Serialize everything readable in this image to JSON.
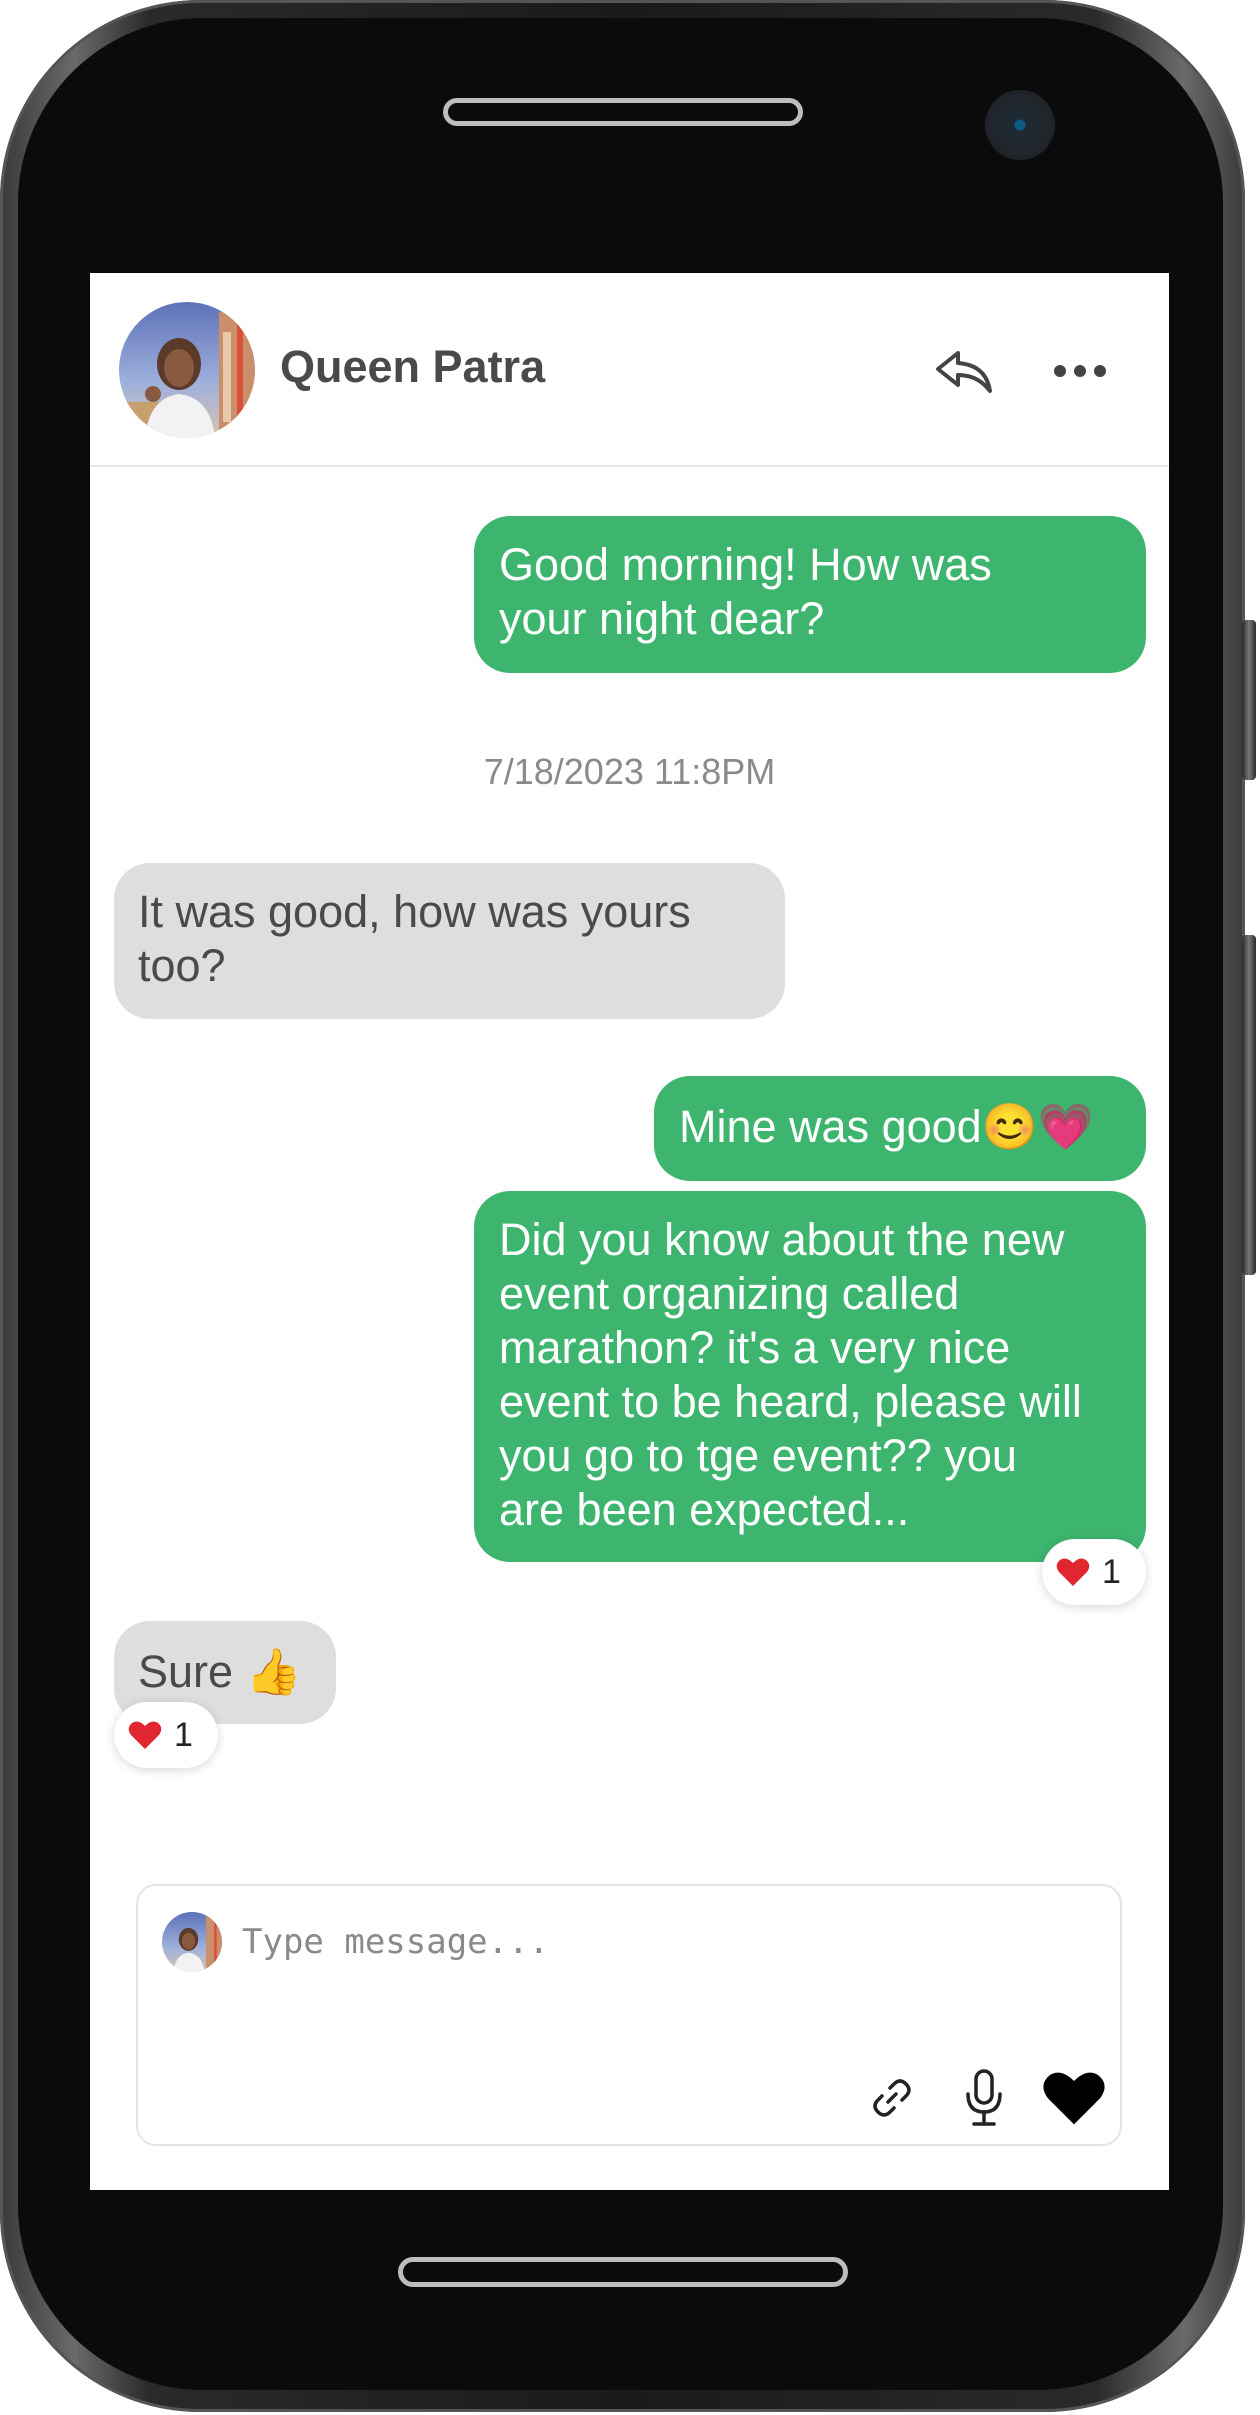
{
  "header": {
    "contact_name": "Queen Patra",
    "avatar": "contact-avatar-photo",
    "icons": [
      "reply-arrow-icon",
      "more-horizontal-icon"
    ]
  },
  "messages": [
    {
      "direction": "sent",
      "text": "Good morning! How was\nyour night dear?"
    },
    {
      "direction": "received",
      "text": "It was good, how was yours\ntoo?"
    },
    {
      "direction": "sent",
      "text": "Mine was good😊💗"
    },
    {
      "direction": "sent",
      "text": "Did you know about the new\nevent organizing called\nmarathon? it's a very nice\nevent to be heard, please will\nyou go to tge event?? you\nare been expected...",
      "reaction": {
        "icon": "heart",
        "count": "1"
      }
    },
    {
      "direction": "received",
      "text": "Sure 👍",
      "reaction": {
        "icon": "heart",
        "count": "1"
      }
    }
  ],
  "timestamp": "7/18/2023 11:8PM",
  "composer": {
    "placeholder": "Type message...",
    "value": "",
    "icons": [
      "link-icon",
      "microphone-icon",
      "heart-icon"
    ]
  },
  "colors": {
    "sent_bubble": "#3db56f",
    "received_bubble": "#dedede",
    "received_text": "#4a4a4a",
    "timestamp": "#8a8a8a",
    "reaction_heart": "#e0262f"
  }
}
